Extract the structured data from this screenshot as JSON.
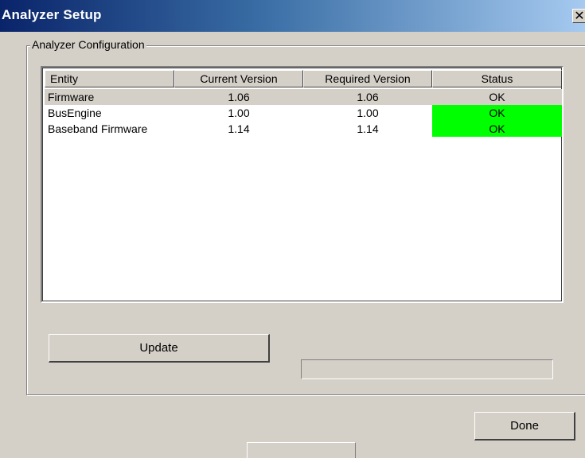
{
  "window": {
    "title": "Analyzer Setup",
    "close_glyph": "✕",
    "close_icon": "close-icon"
  },
  "group": {
    "label": "Analyzer Configuration"
  },
  "table": {
    "columns": [
      "Entity",
      "Current Version",
      "Required Version",
      "Status"
    ],
    "rows": [
      {
        "entity": "Firmware",
        "current": "1.06",
        "required": "1.06",
        "status": "OK",
        "selected": true,
        "status_highlight": false
      },
      {
        "entity": "BusEngine",
        "current": "1.00",
        "required": "1.00",
        "status": "OK",
        "selected": false,
        "status_highlight": true
      },
      {
        "entity": "Baseband Firmware",
        "current": "1.14",
        "required": "1.14",
        "status": "OK",
        "selected": false,
        "status_highlight": true
      }
    ]
  },
  "buttons": {
    "update": "Update",
    "done": "Done"
  },
  "progress": {
    "value": 0
  },
  "colors": {
    "status_ok": "#00ff00",
    "titlebar_start": "#0a246a",
    "titlebar_end": "#a6caf0",
    "dialog_bg": "#d4d0c8"
  }
}
